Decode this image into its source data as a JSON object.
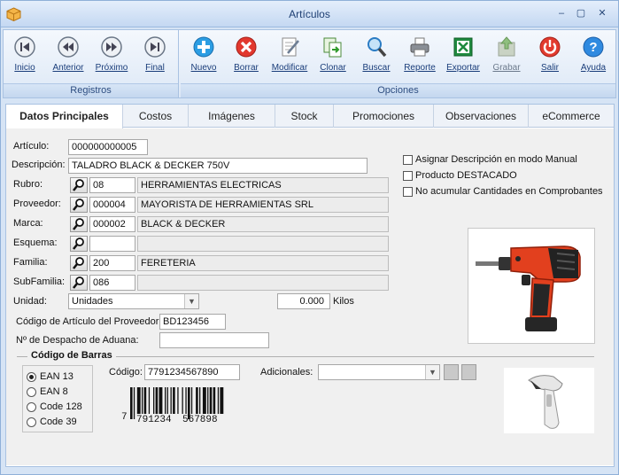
{
  "window": {
    "title": "Artículos"
  },
  "ribbon": {
    "registros": {
      "caption": "Registros",
      "buttons": [
        {
          "label": "Inicio",
          "icon": "first-icon"
        },
        {
          "label": "Anterior",
          "icon": "previous-icon"
        },
        {
          "label": "Próximo",
          "icon": "next-icon"
        },
        {
          "label": "Final",
          "icon": "last-icon"
        }
      ]
    },
    "opciones": {
      "caption": "Opciones",
      "buttons": [
        {
          "label": "Nuevo",
          "icon": "add-icon"
        },
        {
          "label": "Borrar",
          "icon": "delete-icon"
        },
        {
          "label": "Modificar",
          "icon": "edit-icon"
        },
        {
          "label": "Clonar",
          "icon": "clone-icon"
        },
        {
          "label": "Buscar",
          "icon": "search-icon"
        },
        {
          "label": "Reporte",
          "icon": "printer-icon"
        },
        {
          "label": "Exportar",
          "icon": "excel-icon"
        },
        {
          "label": "Grabar",
          "icon": "save-icon"
        },
        {
          "label": "Salir",
          "icon": "power-icon"
        },
        {
          "label": "Ayuda",
          "icon": "help-icon"
        }
      ]
    }
  },
  "tabs": [
    "Datos Principales",
    "Costos",
    "Imágenes",
    "Stock",
    "Promociones",
    "Observaciones",
    "eCommerce"
  ],
  "form": {
    "articulo": {
      "label": "Artículo:",
      "value": "000000000005"
    },
    "descripcion": {
      "label": "Descripción:",
      "value": "TALADRO BLACK & DECKER 750V"
    },
    "rubro": {
      "label": "Rubro:",
      "code": "08",
      "name": "HERRAMIENTAS ELECTRICAS"
    },
    "proveedor": {
      "label": "Proveedor:",
      "code": "000004",
      "name": "MAYORISTA DE HERRAMIENTAS SRL"
    },
    "marca": {
      "label": "Marca:",
      "code": "000002",
      "name": "BLACK & DECKER"
    },
    "esquema": {
      "label": "Esquema:",
      "code": "",
      "name": ""
    },
    "familia": {
      "label": "Familia:",
      "code": "200",
      "name": "FERETERIA"
    },
    "subfamilia": {
      "label": "SubFamilia:",
      "code": "086",
      "name": ""
    },
    "unidad": {
      "label": "Unidad:",
      "value": "Unidades"
    },
    "peso": {
      "value": "0.000",
      "unit": "Kilos"
    },
    "codigo_proveedor": {
      "label": "Código de Artículo del Proveedor:",
      "value": "BD123456"
    },
    "despacho_aduana": {
      "label": "Nº de Despacho de Aduana:",
      "value": ""
    },
    "checks": [
      {
        "label": "Asignar Descripción en modo Manual",
        "checked": false
      },
      {
        "label": "Producto DESTACADO",
        "checked": false
      },
      {
        "label": "No acumular Cantidades en Comprobantes",
        "checked": false
      }
    ]
  },
  "barcode": {
    "section_title": "Código de Barras",
    "types": [
      {
        "label": "EAN 13",
        "selected": true
      },
      {
        "label": "EAN 8",
        "selected": false
      },
      {
        "label": "Code 128",
        "selected": false
      },
      {
        "label": "Code 39",
        "selected": false
      }
    ],
    "code_label": "Código:",
    "code_value": "7791234567890",
    "adicionales_label": "Adicionales:",
    "adicionales_value": "",
    "digits_first": "7",
    "digits_left": "791234",
    "digits_right": "567898"
  }
}
